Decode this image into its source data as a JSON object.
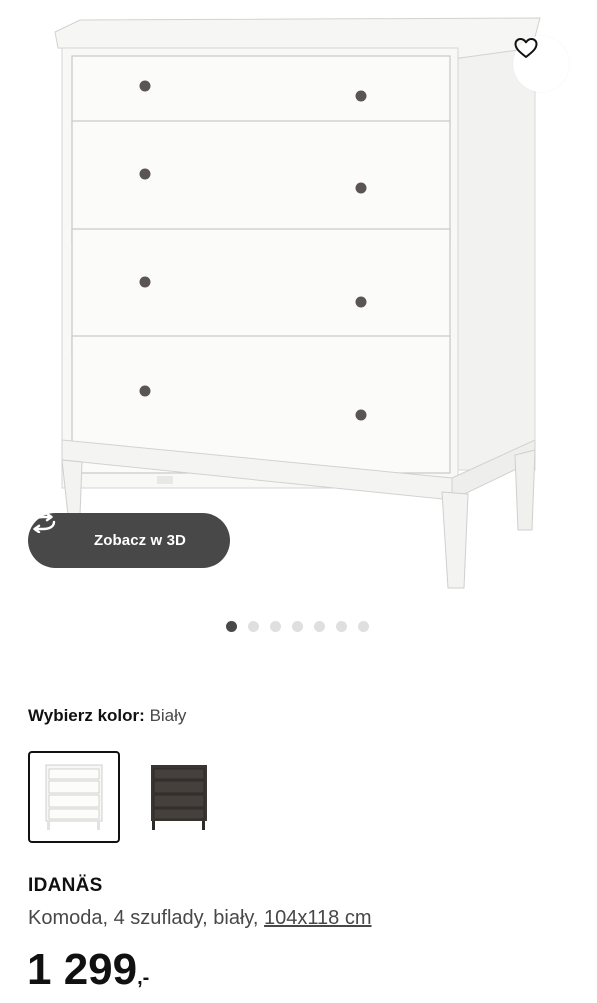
{
  "gallery": {
    "favorite_icon": "heart-icon",
    "view3d": {
      "icon": "rotate-3d-icon",
      "label": "Zobacz w 3D"
    },
    "images_total": 7,
    "active_image_index": 0
  },
  "color_selector": {
    "label": "Wybierz kolor:",
    "selected_value": "Biały",
    "options": [
      {
        "color": "#f4f4f2",
        "selected": true
      },
      {
        "color": "#3b3532",
        "selected": false
      }
    ]
  },
  "product": {
    "name": "IDANÄS",
    "description": "Komoda, 4 szuflady, biały, ",
    "dimensions_link": "104x118 cm",
    "price_main": "1 299",
    "price_suffix": ",-"
  },
  "colors": {
    "pill_bg": "#484848",
    "dot_active": "#484848",
    "dot_inactive": "#dfdfdf",
    "text_primary": "#111111",
    "text_secondary": "#484848"
  }
}
